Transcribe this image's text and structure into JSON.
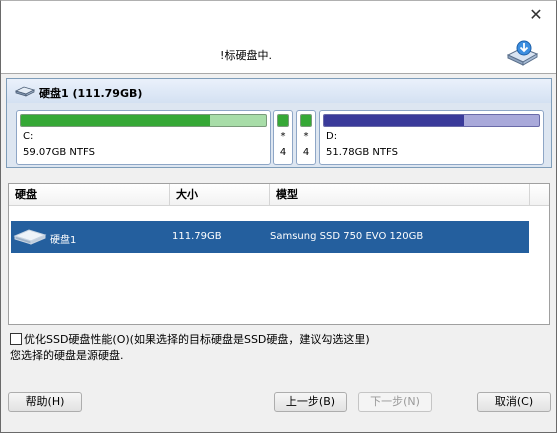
{
  "header": {
    "title": "!标硬盘中."
  },
  "disk_map": {
    "title": "硬盘1 (111.79GB)",
    "partitions": [
      {
        "name": "C:",
        "info": "59.07GB NTFS",
        "used": 0.77,
        "color": "#36a836",
        "light": "#a8dda8"
      },
      {
        "name": "*",
        "info": "4",
        "used": 1.0,
        "color": "#36a836",
        "light": "#a8dda8"
      },
      {
        "name": "*",
        "info": "4",
        "used": 1.0,
        "color": "#36a836",
        "light": "#a8dda8"
      },
      {
        "name": "D:",
        "info": "51.78GB NTFS",
        "used": 0.65,
        "color": "#3a3a9a",
        "light": "#a9a9da"
      }
    ]
  },
  "list": {
    "columns": [
      "硬盘",
      "大小",
      "模型"
    ],
    "rows": [
      {
        "disk": "硬盘1",
        "size": "111.79GB",
        "model": "Samsung SSD 750 EVO 120GB",
        "selected": true
      }
    ]
  },
  "options": {
    "ssd_optimize_label": "优化SSD硬盘性能(O)(如果选择的目标硬盘是SSD硬盘，建议勾选这里)",
    "ssd_optimize_checked": false,
    "note": "您选择的硬盘是源硬盘."
  },
  "buttons": {
    "help": "帮助(H)",
    "back": "上一步(B)",
    "next": "下一步(N)",
    "cancel": "取消(C)"
  },
  "colors": {
    "selection": "#245f9e",
    "panel_border": "#7f9db9"
  },
  "icons": {
    "close": "close-icon",
    "header": "disk-download-icon",
    "disk": "hard-disk-icon"
  }
}
